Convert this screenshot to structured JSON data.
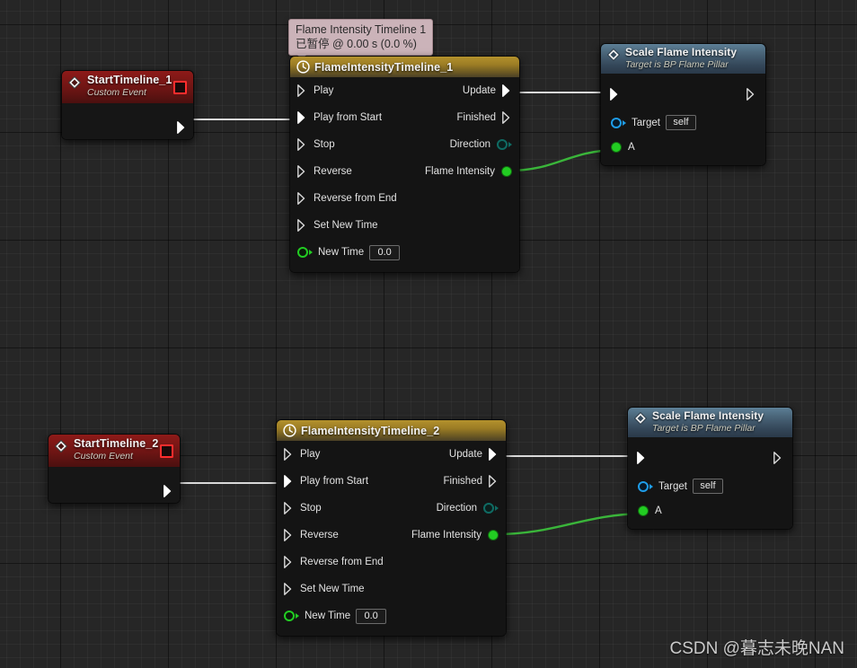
{
  "canvas": {
    "background_color": "#262626",
    "grid_minor_color": "#2e2e2e",
    "grid_major_color": "#000000"
  },
  "tooltip": {
    "line1": "Flame Intensity Timeline 1",
    "line2": "已暂停 @ 0.00 s (0.0 %)"
  },
  "watermark": {
    "text": "CSDN @暮志未晚NAN"
  },
  "colors": {
    "exec_wire": "#d9d9d9",
    "float_wire": "#22b422",
    "float_pin": "#22cc22",
    "object_pin": "#1e9ce8",
    "bool_pin": "#0f6b63",
    "delegate_pin": "#ff2d2d",
    "event_header": "#7e1817",
    "timeline_header": "#9b7c24",
    "function_header": "#4a6579"
  },
  "nodes": {
    "start_timeline_1": {
      "title": "StartTimeline_1",
      "subtitle": "Custom Event",
      "icon": "event-diamond-icon",
      "delegate_pin": "delegate-output-pin",
      "exec_out": ""
    },
    "timeline_1": {
      "title": "FlameIntensityTimeline_1",
      "icon": "clock-icon",
      "inputs": [
        {
          "label": "Play",
          "type": "exec",
          "connected": false
        },
        {
          "label": "Play from Start",
          "type": "exec",
          "connected": true
        },
        {
          "label": "Stop",
          "type": "exec",
          "connected": false
        },
        {
          "label": "Reverse",
          "type": "exec",
          "connected": false
        },
        {
          "label": "Reverse from End",
          "type": "exec",
          "connected": false
        },
        {
          "label": "Set New Time",
          "type": "exec",
          "connected": false
        },
        {
          "label": "New Time",
          "type": "float",
          "connected": false,
          "value": "0.0"
        }
      ],
      "outputs": [
        {
          "label": "Update",
          "type": "exec",
          "connected": true
        },
        {
          "label": "Finished",
          "type": "exec",
          "connected": false
        },
        {
          "label": "Direction",
          "type": "byte",
          "connected": false
        },
        {
          "label": "Flame Intensity",
          "type": "float",
          "connected": true
        }
      ]
    },
    "scale_flame_1": {
      "title": "Scale Flame Intensity",
      "subtitle": "Target is BP Flame Pillar",
      "icon": "function-diamond-icon",
      "exec_in": "",
      "exec_out": "",
      "inputs": [
        {
          "label": "Target",
          "type": "object",
          "value": "self"
        },
        {
          "label": "A",
          "type": "float",
          "connected": true
        }
      ]
    },
    "start_timeline_2": {
      "title": "StartTimeline_2",
      "subtitle": "Custom Event",
      "icon": "event-diamond-icon",
      "delegate_pin": "delegate-output-pin",
      "exec_out": ""
    },
    "timeline_2": {
      "title": "FlameIntensityTimeline_2",
      "icon": "clock-icon",
      "inputs": [
        {
          "label": "Play",
          "type": "exec",
          "connected": false
        },
        {
          "label": "Play from Start",
          "type": "exec",
          "connected": true
        },
        {
          "label": "Stop",
          "type": "exec",
          "connected": false
        },
        {
          "label": "Reverse",
          "type": "exec",
          "connected": false
        },
        {
          "label": "Reverse from End",
          "type": "exec",
          "connected": false
        },
        {
          "label": "Set New Time",
          "type": "exec",
          "connected": false
        },
        {
          "label": "New Time",
          "type": "float",
          "connected": false,
          "value": "0.0"
        }
      ],
      "outputs": [
        {
          "label": "Update",
          "type": "exec",
          "connected": true
        },
        {
          "label": "Finished",
          "type": "exec",
          "connected": false
        },
        {
          "label": "Direction",
          "type": "byte",
          "connected": false
        },
        {
          "label": "Flame Intensity",
          "type": "float",
          "connected": true
        }
      ]
    },
    "scale_flame_2": {
      "title": "Scale Flame Intensity",
      "subtitle": "Target is BP Flame Pillar",
      "icon": "function-diamond-icon",
      "exec_in": "",
      "exec_out": "",
      "inputs": [
        {
          "label": "Target",
          "type": "object",
          "value": "self"
        },
        {
          "label": "A",
          "type": "float",
          "connected": true
        }
      ]
    }
  }
}
